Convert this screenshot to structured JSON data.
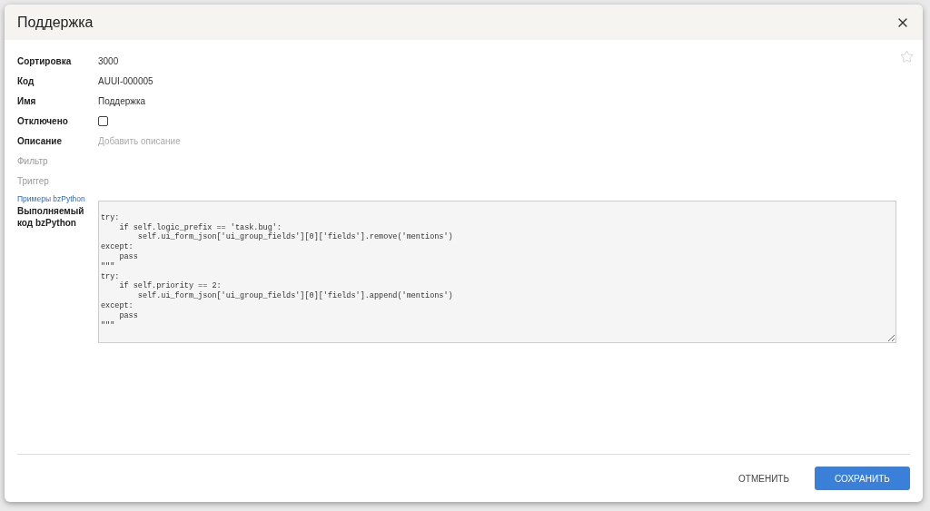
{
  "dialog": {
    "title": "Поддержка",
    "favorite": false
  },
  "fields": [
    {
      "kind": "value",
      "label": "Сортировка",
      "value": "3000"
    },
    {
      "kind": "value",
      "label": "Код",
      "value": "AUUI-000005"
    },
    {
      "kind": "value",
      "label": "Имя",
      "value": "Поддержка"
    },
    {
      "kind": "checkbox",
      "label": "Отключено",
      "checked": false
    },
    {
      "kind": "placeholder",
      "label": "Описание",
      "placeholder": "Добавить описание"
    },
    {
      "kind": "empty",
      "label": "Фильтр"
    },
    {
      "kind": "empty",
      "label": "Триггер"
    }
  ],
  "code_field": {
    "link": "Примеры bzPython",
    "label": "Выполняемый код bzPython",
    "value": "\ntry:\n    if self.logic_prefix == 'task.bug':\n        self.ui_form_json['ui_group_fields'][0]['fields'].remove('mentions')\nexcept:\n    pass\n\"\"\"\ntry:\n    if self.priority == 2:\n        self.ui_form_json['ui_group_fields'][0]['fields'].append('mentions')\nexcept:\n    pass\n\"\"\""
  },
  "buttons": [
    {
      "kind": "flat",
      "label": "ОТМЕНИТЬ"
    },
    {
      "kind": "primary",
      "label": "СОХРАНИТЬ"
    }
  ]
}
